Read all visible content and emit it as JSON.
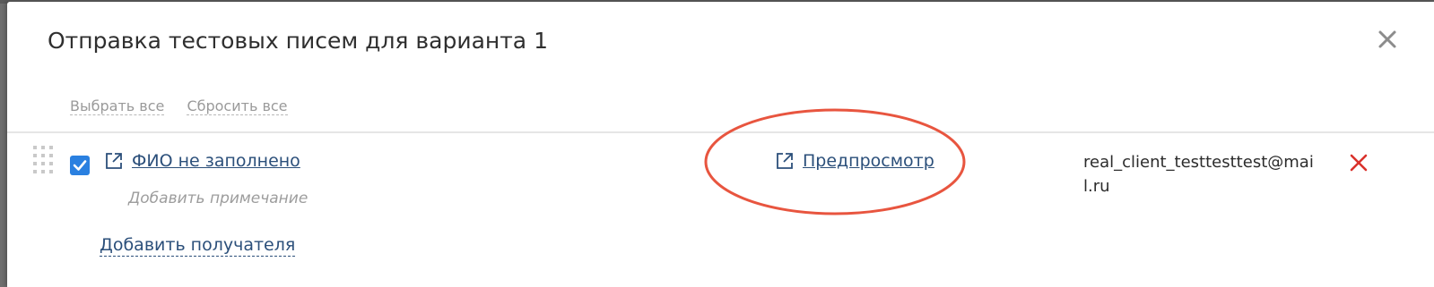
{
  "dialog": {
    "title": "Отправка тестовых писем для варианта 1",
    "close_icon": "close-icon"
  },
  "toolbar": {
    "select_all": "Выбрать все",
    "reset_all": "Сбросить все"
  },
  "recipients": [
    {
      "checked": true,
      "name": "ФИО не заполнено",
      "note_placeholder": "Добавить примечание",
      "preview_label": "Предпросмотр",
      "email": "real_client_testtesttest@mail.ru"
    }
  ],
  "add_recipient_label": "Добавить получателя",
  "colors": {
    "checkbox": "#2a80e0",
    "link": "#2b4f7a",
    "remove": "#d9312b",
    "annotation": "#e8553f"
  }
}
